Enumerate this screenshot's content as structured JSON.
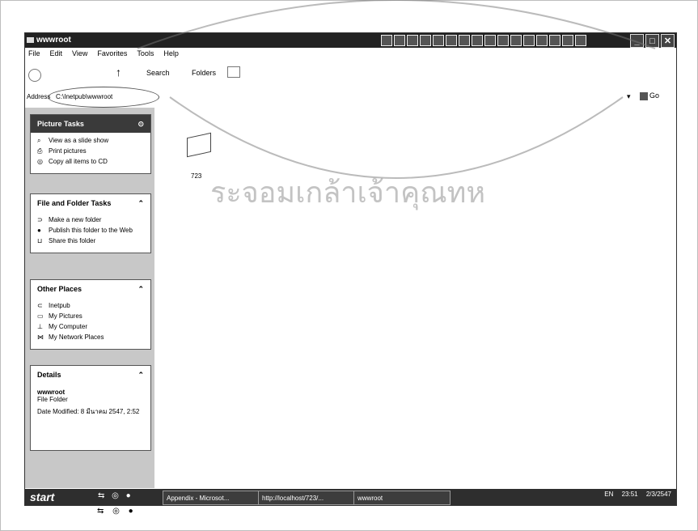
{
  "window": {
    "title": "wwwroot"
  },
  "menu": [
    "File",
    "Edit",
    "View",
    "Favorites",
    "Tools",
    "Help"
  ],
  "toolbar": {
    "search_label": "Search",
    "folders_label": "Folders"
  },
  "address": {
    "label": "Address",
    "path": "C:\\Inetpub\\wwwroot",
    "go_label": "Go"
  },
  "panels": {
    "picture_tasks": {
      "title": "Picture Tasks",
      "items": [
        "View as a slide show",
        "Print pictures",
        "Copy all items to CD"
      ]
    },
    "file_folder_tasks": {
      "title": "File and Folder Tasks",
      "items": [
        "Make a new folder",
        "Publish this folder to the Web",
        "Share this folder"
      ]
    },
    "other_places": {
      "title": "Other Places",
      "items": [
        "Inetpub",
        "My Pictures",
        "My Computer",
        "My Network Places"
      ]
    },
    "details": {
      "title": "Details",
      "name": "wwwroot",
      "type": "File Folder",
      "modified": "Date Modified: 8 มีนาคม 2547, 2:52"
    }
  },
  "content": {
    "folder_label": "723"
  },
  "taskbar": {
    "start_label": "start",
    "buttons": [
      "Appendix - Microsot...",
      "http://localhost/723/...",
      "wwwroot"
    ],
    "lang": "EN",
    "time": "23:51",
    "date": "2/3/2547"
  },
  "watermark": {
    "text": "ระจอมเกล้าเจ้าคุณทห"
  },
  "colors": {
    "taskbar": "#2e2e2e",
    "titlebar": "#222222",
    "sidebar": "#c8c8c8"
  }
}
